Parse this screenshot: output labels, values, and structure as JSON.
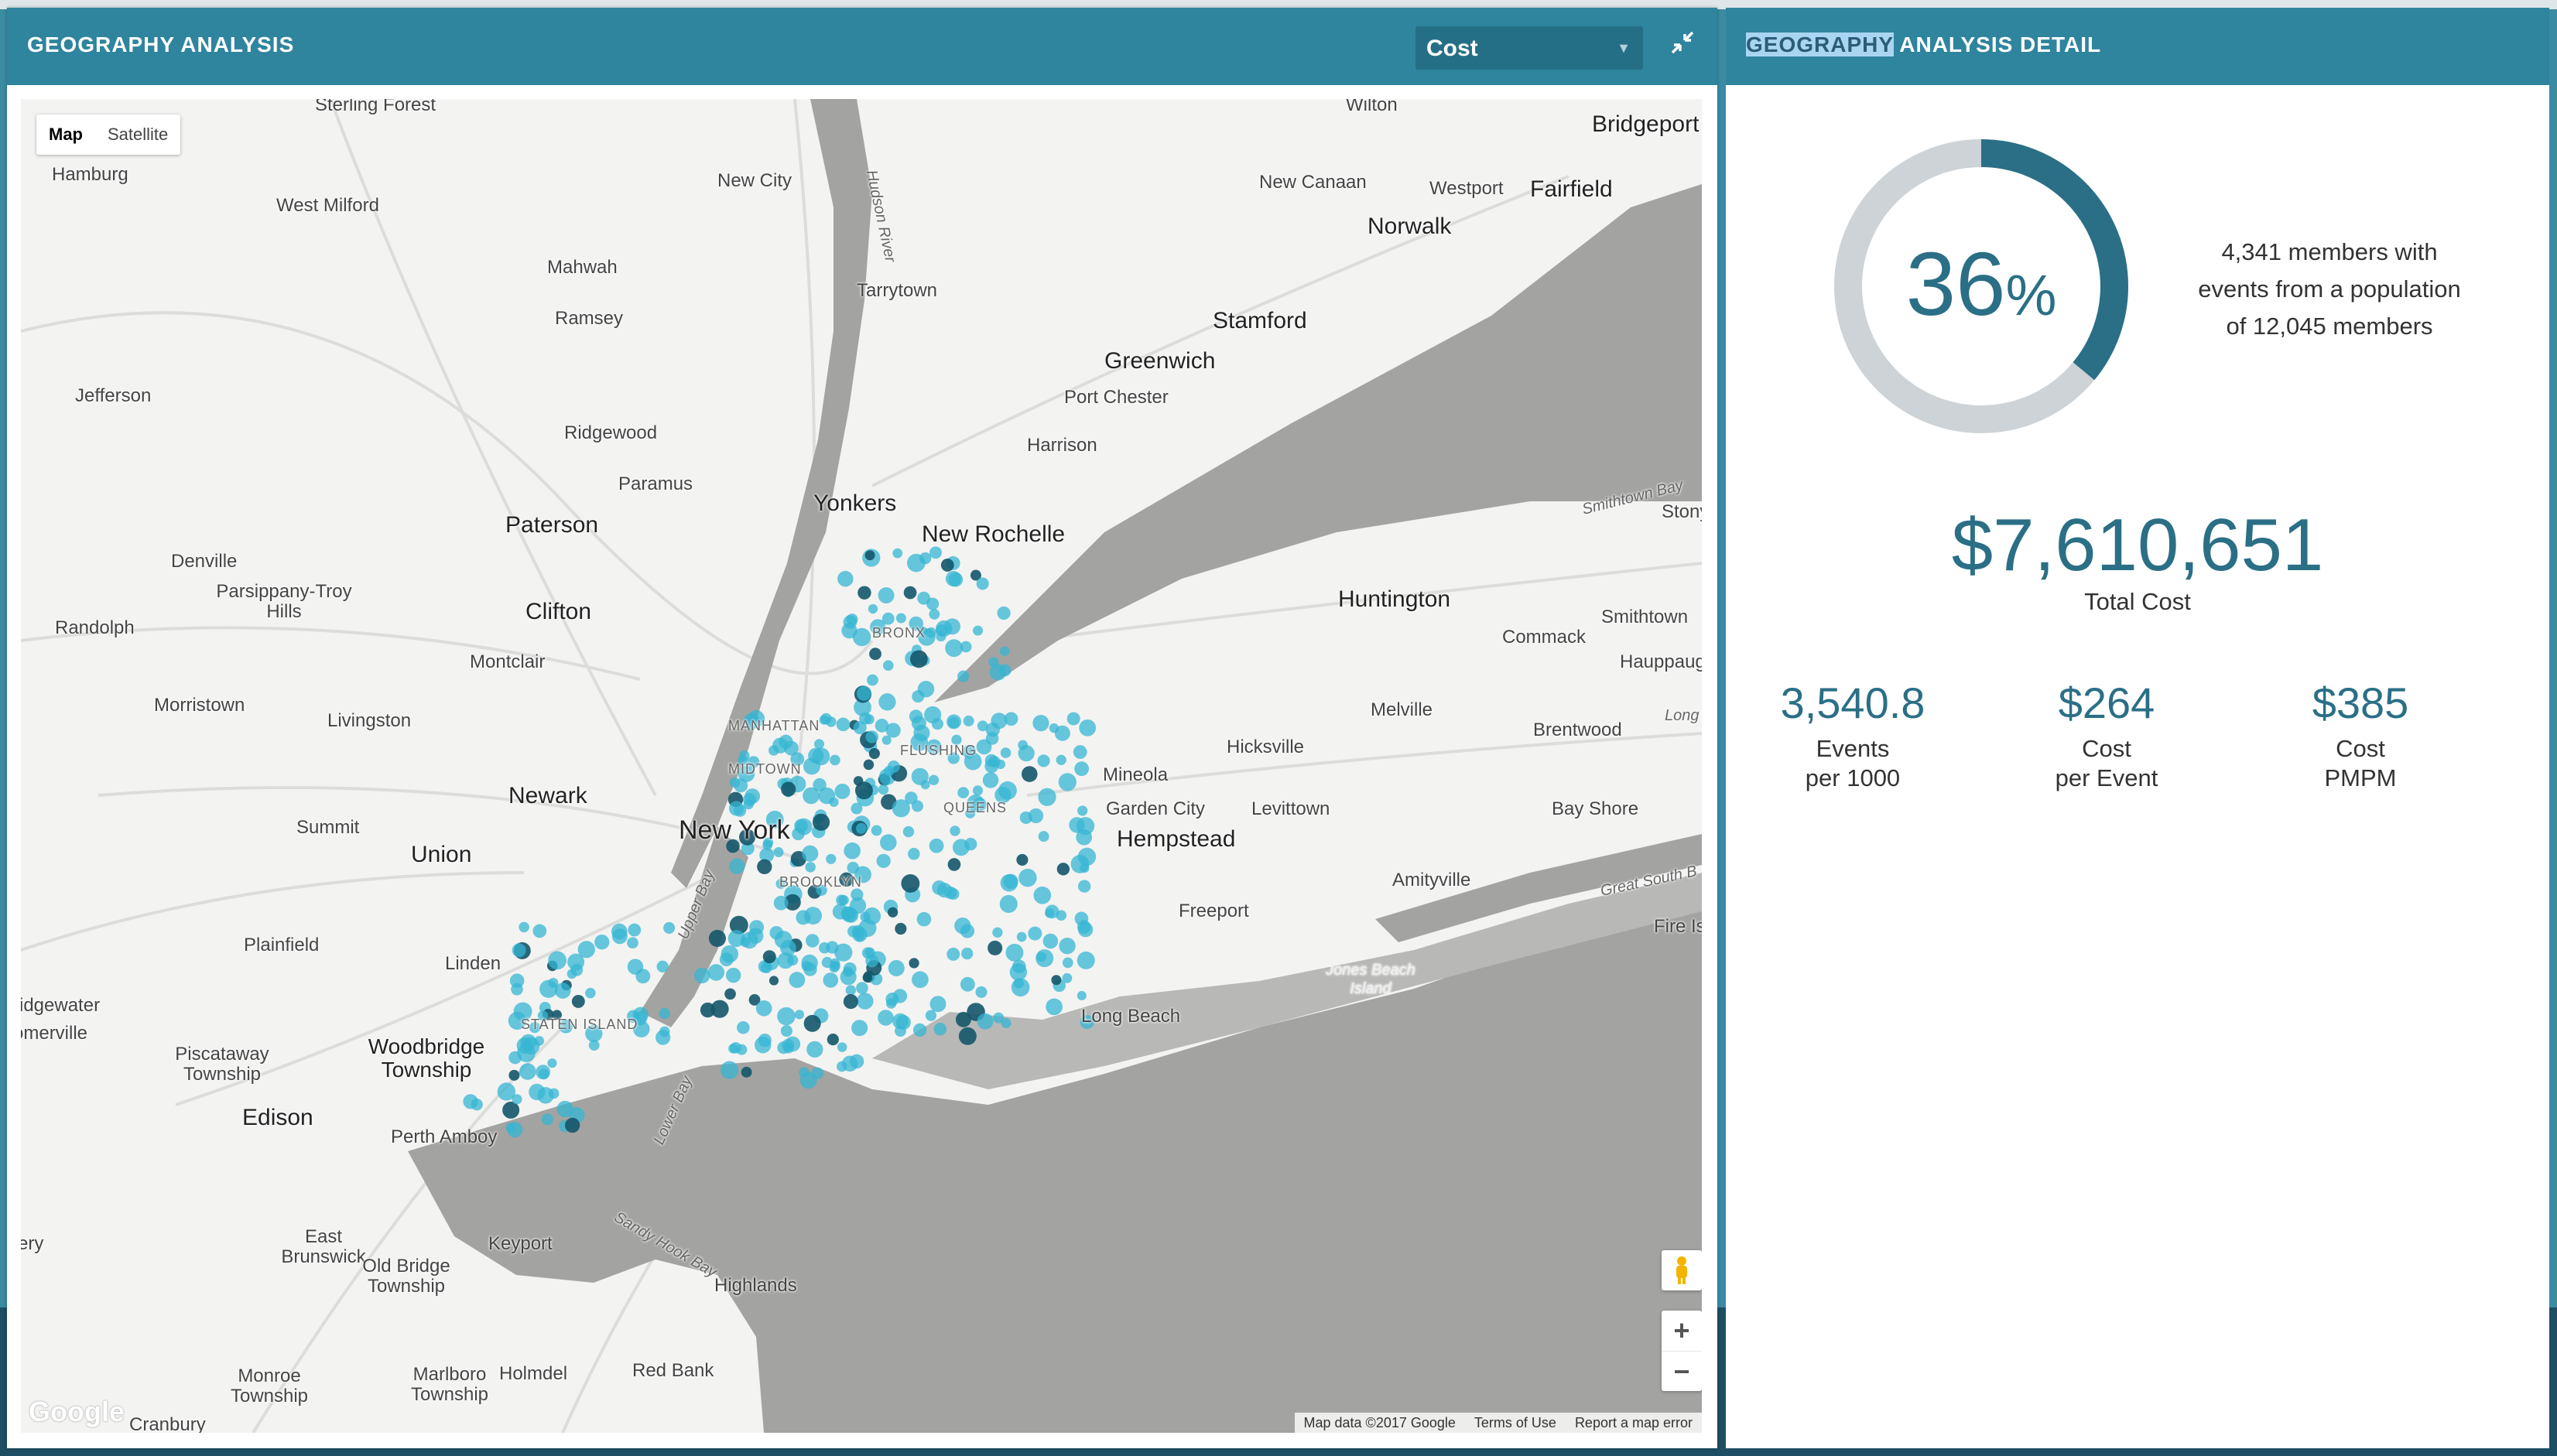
{
  "left_panel": {
    "title": "GEOGRAPHY ANALYSIS",
    "metric_select": {
      "value": "Cost"
    },
    "collapse_icon": "collapse-arrows-icon"
  },
  "map": {
    "map_type": {
      "map": "Map",
      "satellite": "Satellite"
    },
    "zoom_in": "+",
    "zoom_out": "−",
    "attribution": {
      "data": "Map data ©2017 Google",
      "terms": "Terms of Use",
      "report": "Report a map error"
    },
    "logo": "Google",
    "labels": {
      "sterling_forest": "Sterling Forest",
      "hamburg": "Hamburg",
      "west_milford": "West Milford",
      "new_city": "New City",
      "hudson_river": "Hudson River",
      "wilton": "Wilton",
      "bridgeport": "Bridgeport",
      "new_canaan": "New Canaan",
      "westport": "Westport",
      "fairfield": "Fairfield",
      "norwalk": "Norwalk",
      "mahwah": "Mahwah",
      "tarrytown": "Tarrytown",
      "ramsey": "Ramsey",
      "stamford": "Stamford",
      "jefferson": "Jefferson",
      "greenwich": "Greenwich",
      "port_chester": "Port Chester",
      "ridgewood": "Ridgewood",
      "harrison": "Harrison",
      "paramus": "Paramus",
      "yonkers": "Yonkers",
      "new_rochelle": "New Rochelle",
      "smithtown_bay": "Smithtown Bay",
      "stony": "Stony",
      "paterson": "Paterson",
      "denville": "Denville",
      "parsippany": "Parsippany-Troy Hills",
      "clifton": "Clifton",
      "huntington": "Huntington",
      "randolph": "Randolph",
      "bronx": "BRONX",
      "commack": "Commack",
      "smithtown": "Smithtown",
      "montclair": "Montclair",
      "hauppauge": "Hauppauge",
      "morristown": "Morristown",
      "livingston": "Livingston",
      "manhattan": "MANHATTAN",
      "melville": "Melville",
      "brentwood": "Brentwood",
      "long": "Long",
      "midtown": "MIDTOWN",
      "flushing": "FLUSHING",
      "hicksville": "Hicksville",
      "mineola": "Mineola",
      "newark": "Newark",
      "queens": "QUEENS",
      "garden_city": "Garden City",
      "levittown": "Levittown",
      "bay_shore": "Bay Shore",
      "new_york": "New York",
      "summit": "Summit",
      "hempstead": "Hempstead",
      "union": "Union",
      "brooklyn": "BROOKLYN",
      "amityville": "Amityville",
      "upper_bay": "Upper Bay",
      "great_south_bay": "Great South B",
      "freeport": "Freeport",
      "plainfield": "Plainfield",
      "fire_is": "Fire Is",
      "linden": "Linden",
      "jones_beach": "Jones Beach Island",
      "ridgewater": "ridgewater",
      "somerville": "omerville",
      "staten_island": "STATEN ISLAND",
      "long_beach": "Long Beach",
      "piscataway": "Piscataway Township",
      "woodbridge": "Woodbridge Township",
      "edison": "Edison",
      "lower_bay": "Lower Bay",
      "perth_amboy": "Perth Amboy",
      "sandy_hook": "Sandy Hook Bay",
      "east_brunswick": "East Brunswick",
      "keyport": "Keyport",
      "ery": "ery",
      "old_bridge": "Old Bridge Township",
      "highlands": "Highlands",
      "monroe": "Monroe Township",
      "marlboro": "Marlboro Township",
      "holmdel": "Holmdel",
      "red_bank": "Red Bank",
      "cranbury": "Cranbury"
    }
  },
  "right_panel": {
    "title_highlight": "GEOGRAPHY",
    "title_rest": " ANALYSIS DETAIL",
    "percent_value": "36",
    "percent_symbol": "%",
    "percent_fraction": 0.36,
    "members_line1": "4,341 members with",
    "members_line2": "events from a population",
    "members_line3": "of 12,045 members",
    "total_value": "$7,610,651",
    "total_label": "Total Cost",
    "kpis": [
      {
        "value": "3,540.8",
        "label1": "Events",
        "label2": "per 1000"
      },
      {
        "value": "$264",
        "label1": "Cost",
        "label2": "per Event"
      },
      {
        "value": "$385",
        "label1": "Cost",
        "label2": "PMPM"
      }
    ]
  },
  "colors": {
    "header": "#2f849e",
    "accent": "#2a6f86",
    "donut_track": "#cdd3d6",
    "water": "#a3a3a1",
    "heat_point": "#35b5d3"
  }
}
